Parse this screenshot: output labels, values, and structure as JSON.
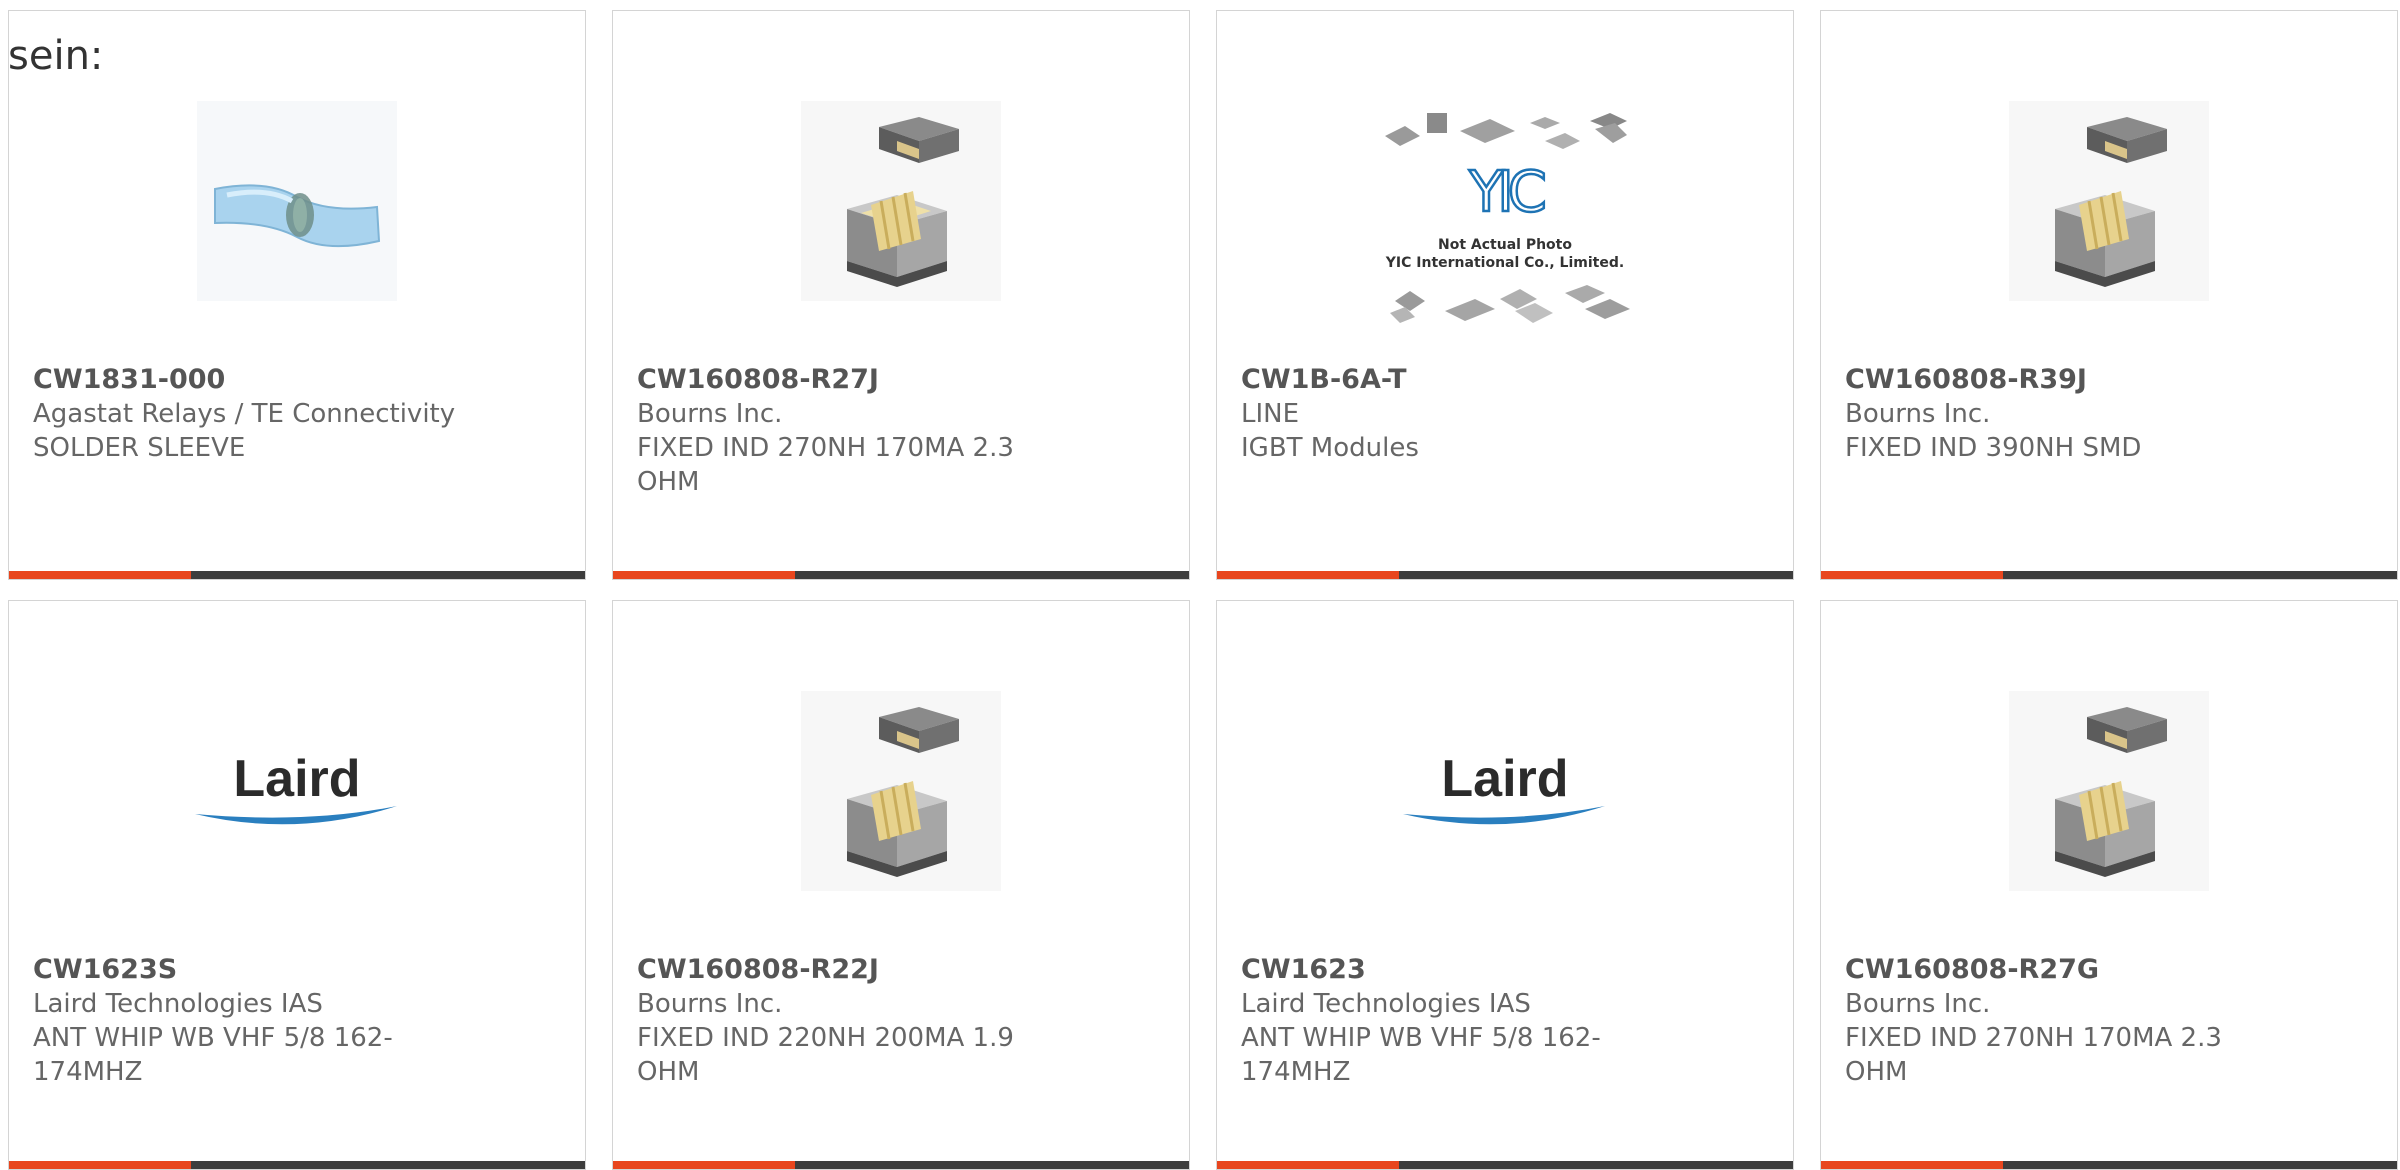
{
  "heading": "sein:",
  "colors": {
    "accent": "#e8461e",
    "bar": "#3d3d3d"
  },
  "products": [
    {
      "part_number": "CW1831-000",
      "manufacturer": "Agastat Relays / TE Connectivity",
      "description": "SOLDER SLEEVE",
      "image": "solder-sleeve"
    },
    {
      "part_number": "CW160808-R27J",
      "manufacturer": "Bourns Inc.",
      "description": "FIXED IND 270NH 170MA 2.3 OHM",
      "image": "smd-inductor"
    },
    {
      "part_number": "CW1B-6A-T",
      "manufacturer": "LINE",
      "description": "IGBT Modules",
      "image": "yic-placeholder",
      "image_text": [
        "YIC",
        "Not Actual Photo",
        "YIC International Co., Limited."
      ]
    },
    {
      "part_number": "CW160808-R39J",
      "manufacturer": "Bourns Inc.",
      "description": "FIXED IND 390NH SMD",
      "image": "smd-inductor"
    },
    {
      "part_number": "CW1623S",
      "manufacturer": "Laird Technologies IAS",
      "description": "ANT WHIP WB VHF 5/8 162-174MHZ",
      "image": "laird-logo",
      "logo_text": "Laird"
    },
    {
      "part_number": "CW160808-R22J",
      "manufacturer": "Bourns Inc.",
      "description": "FIXED IND 220NH 200MA 1.9 OHM",
      "image": "smd-inductor"
    },
    {
      "part_number": "CW1623",
      "manufacturer": "Laird Technologies IAS",
      "description": "ANT WHIP WB VHF 5/8 162-174MHZ",
      "image": "laird-logo",
      "logo_text": "Laird"
    },
    {
      "part_number": "CW160808-R27G",
      "manufacturer": "Bourns Inc.",
      "description": "FIXED IND 270NH 170MA 2.3 OHM",
      "image": "smd-inductor"
    }
  ]
}
